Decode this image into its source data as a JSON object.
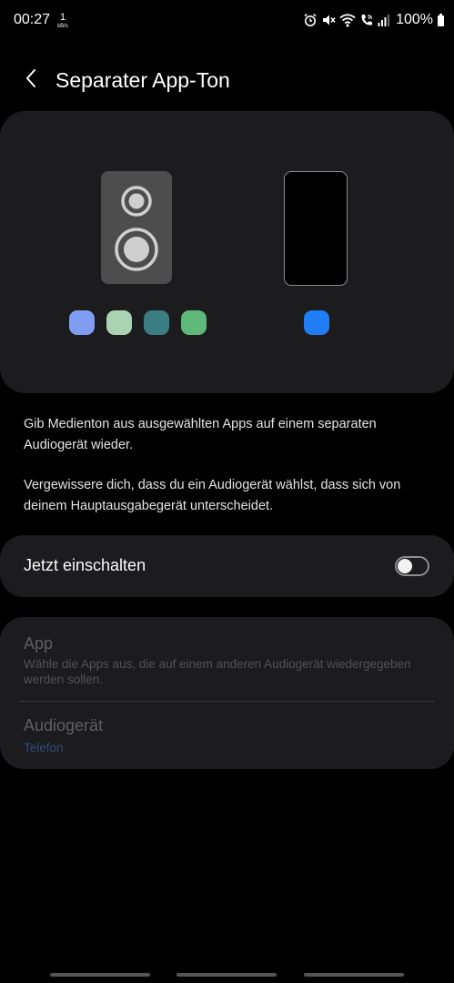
{
  "status_bar": {
    "time": "00:27",
    "net_speed_value": "1",
    "net_speed_unit": "kB/s",
    "battery": "100%",
    "icons": [
      "alarm-icon",
      "mute-icon",
      "wifi-icon",
      "wifi-calling-icon",
      "signal-icon",
      "battery-icon"
    ]
  },
  "header": {
    "back_icon": "chevron-left-icon",
    "title": "Separater App-Ton"
  },
  "illustration": {
    "app_dot_colors": [
      "#7f9df3",
      "#a9d3b3",
      "#3a7d82",
      "#5db879"
    ],
    "device_dot_color": "#1f7ef5",
    "speaker_color": "#4d4d4d",
    "phone_border_color": "#8c8c8c"
  },
  "description": {
    "paragraph_1": "Gib Medienton aus ausgewählten Apps auf einem separaten Audiogerät wieder.",
    "paragraph_2": "Vergewissere dich, dass du ein Audiogerät wählst, dass sich von deinem Hauptausgabegerät unterscheidet."
  },
  "toggle": {
    "label": "Jetzt einschalten",
    "on": false
  },
  "settings": {
    "app_title": "App",
    "app_subtitle": "Wähle die Apps aus, die auf einem anderen Audiogerät wiedergegeben werden sollen.",
    "audio_title": "Audiogerät",
    "audio_value": "Telefon",
    "accent_color": "#2f4d7a"
  }
}
